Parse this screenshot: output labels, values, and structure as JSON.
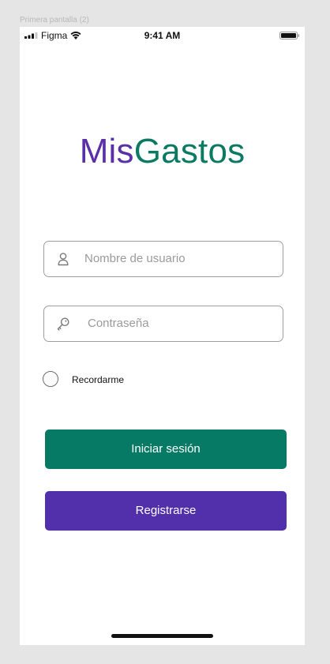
{
  "frame": {
    "label": "Primera pantalla (2)"
  },
  "status_bar": {
    "carrier": "Figma",
    "time": "9:41 AM",
    "icons": [
      "signal-icon",
      "wifi-icon",
      "battery-icon"
    ]
  },
  "logo": {
    "part1": "Mis",
    "part2": "Gastos",
    "color1": "#5b2fa6",
    "color2": "#0a7a63"
  },
  "form": {
    "username": {
      "placeholder": "Nombre de usuario",
      "value": "",
      "icon": "user-icon"
    },
    "password": {
      "placeholder": "Contraseña",
      "value": "",
      "icon": "key-icon"
    },
    "remember": {
      "label": "Recordarme",
      "checked": false
    }
  },
  "buttons": {
    "login": {
      "label": "Iniciar sesión",
      "color": "#077a66"
    },
    "register": {
      "label": "Registrarse",
      "color": "#5330ab"
    }
  }
}
